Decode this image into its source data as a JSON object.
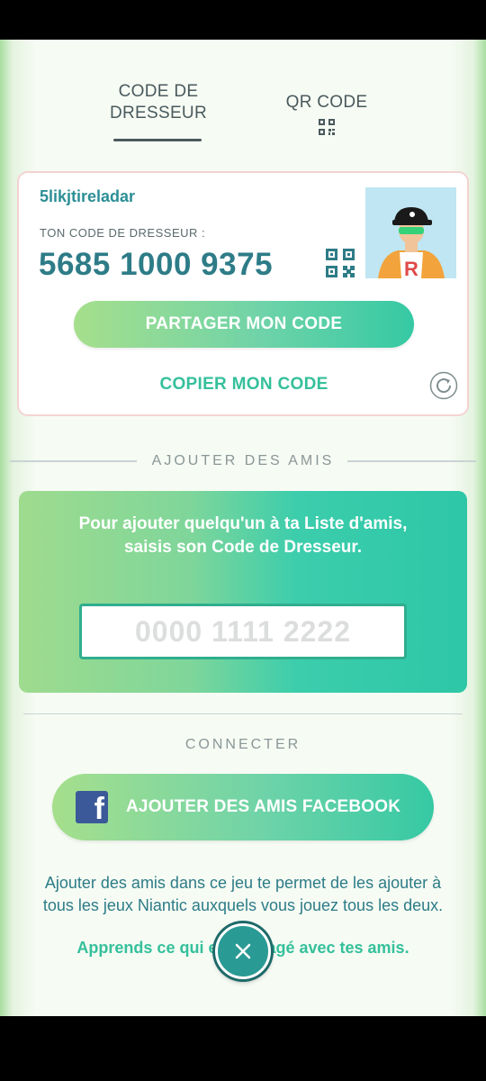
{
  "tabs": [
    {
      "label": "CODE DE DRESSEUR",
      "line1": "CODE DE",
      "line2": "DRESSEUR",
      "active": true
    },
    {
      "label": "QR CODE",
      "active": false
    }
  ],
  "card": {
    "username": "5likjtireladar",
    "code_caption": "TON CODE DE DRESSEUR :",
    "trainer_code": "5685 1000 9375",
    "share_label": "PARTAGER MON CODE",
    "copy_label": "COPIER MON CODE"
  },
  "add_friends": {
    "section_title": "AJOUTER DES AMIS",
    "instructions": "Pour ajouter quelqu'un à ta Liste d'amis, saisis son Code de Dresseur.",
    "input_placeholder": "0000 1111 2222",
    "input_value": ""
  },
  "connect": {
    "section_title": "CONNECTER",
    "facebook_label": "AJOUTER DES AMIS FACEBOOK",
    "info": "Ajouter des amis dans ce jeu te permet de les ajouter à tous les jeux Niantic auxquels vous jouez tous les deux.",
    "learn_more": "Apprends ce qui est partagé avec tes amis."
  },
  "colors": {
    "accent_teal": "#2d7c87",
    "accent_green": "#35c09b",
    "facebook_blue": "#3b5998"
  },
  "icons": [
    "qr-code-icon",
    "refresh-icon",
    "facebook-icon",
    "close-icon"
  ]
}
